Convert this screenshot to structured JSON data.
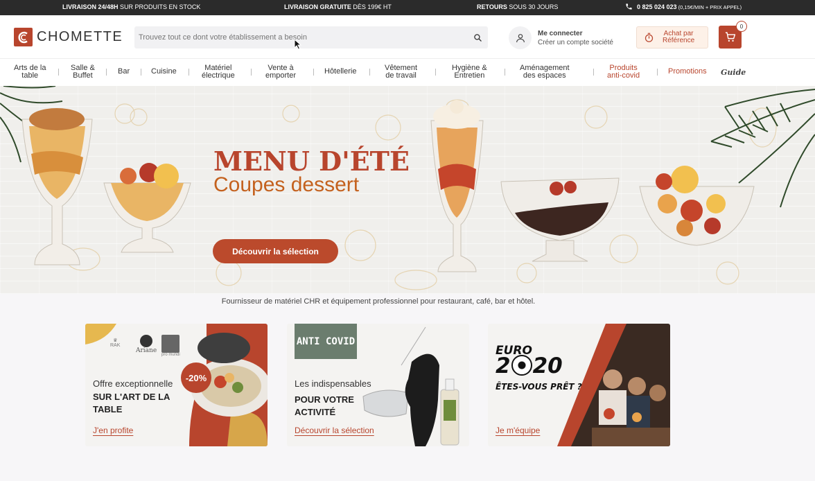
{
  "topbar": {
    "item1_bold": "LIVRAISON 24/48H",
    "item1_rest": " SUR PRODUITS EN STOCK",
    "item2_bold": "LIVRAISON GRATUITE",
    "item2_rest": " DÈS 199€ HT",
    "item3_bold": "RETOURS",
    "item3_rest": " SOUS 30 JOURS",
    "phone_bold": "0 825 024 023",
    "phone_rest": " (0,15€/MIN + PRIX APPEL)"
  },
  "header": {
    "logo": "CHOMETTE",
    "search_placeholder": "Trouvez tout ce dont votre établissement a besoin",
    "account_title": "Me connecter",
    "account_sub": "Créer un compte société",
    "achat_line1": "Achat par",
    "achat_line2": "Référence",
    "cart_count": "0"
  },
  "nav": {
    "items": [
      {
        "l1": "Arts de la",
        "l2": "table"
      },
      {
        "l1": "Salle &",
        "l2": "Buffet"
      },
      {
        "l1": "Bar",
        "l2": ""
      },
      {
        "l1": "Cuisine",
        "l2": ""
      },
      {
        "l1": "Matériel",
        "l2": "électrique"
      },
      {
        "l1": "Vente à",
        "l2": "emporter"
      },
      {
        "l1": "Hôtellerie",
        "l2": ""
      },
      {
        "l1": "Vêtement",
        "l2": "de travail"
      },
      {
        "l1": "Hygiène &",
        "l2": "Entretien"
      },
      {
        "l1": "Aménagement",
        "l2": "des espaces"
      },
      {
        "l1": "Produits",
        "l2": "anti-covid"
      },
      {
        "l1": "Promotions",
        "l2": ""
      }
    ],
    "guide": "Guide"
  },
  "hero": {
    "title": "MENU D'ÉTÉ",
    "subtitle": "Coupes dessert",
    "cta": "Découvrir la sélection"
  },
  "tagline": "Fournisseur de matériel CHR et équipement professionnel pour restaurant, café, bar et hôtel.",
  "cards": [
    {
      "brands": [
        "RAK",
        "Ariane",
        "pro mundi"
      ],
      "badge": "-20%",
      "line1": "Offre exceptionnelle",
      "line2": "SUR L'ART DE LA",
      "line3": "TABLE",
      "link": "J'en profite"
    },
    {
      "badge": "ANTI COVID",
      "line1": "Les indispensables",
      "line2": "POUR VOTRE",
      "line3": "ACTIVITÉ",
      "link": "Découvrir la sélection"
    },
    {
      "euro_word": "EURO",
      "euro_year_a": "2",
      "euro_year_b": "20",
      "tag": "ÊTES-VOUS PRÊT ?",
      "link": "Je m'équipe"
    }
  ],
  "colors": {
    "brand": "#b8452d",
    "topbar": "#2b2b2b",
    "covid": "#6b7d6e"
  }
}
